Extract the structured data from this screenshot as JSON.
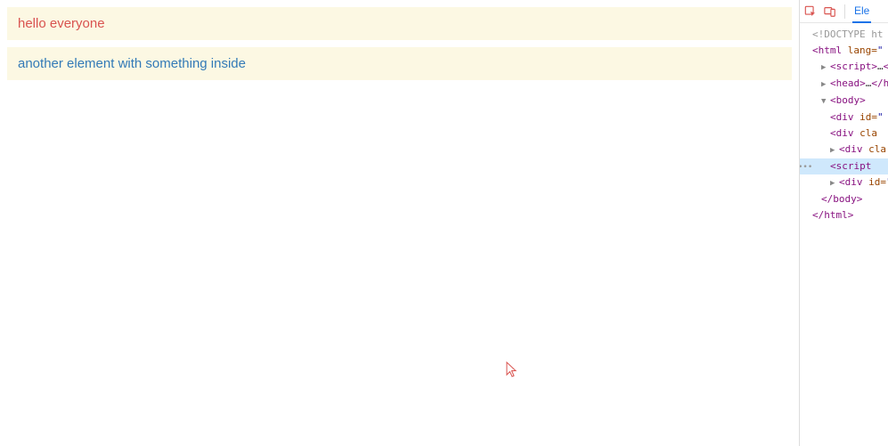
{
  "content": {
    "banner1": "hello everyone",
    "banner2": "another element with something inside"
  },
  "devtools": {
    "tab_label": "Ele",
    "dom": {
      "doctype": "<!DOCTYPE ht",
      "html_open": {
        "lang_attr": "lang="
      },
      "script_collapsed": "…",
      "head_collapsed": "…",
      "body_open": "body",
      "div1_attr": "id=",
      "div2_attr": "cla",
      "div3_attr": "cla",
      "script_sel": "script",
      "div4_attr": "id=",
      "body_close": "body",
      "html_close": "html"
    }
  }
}
